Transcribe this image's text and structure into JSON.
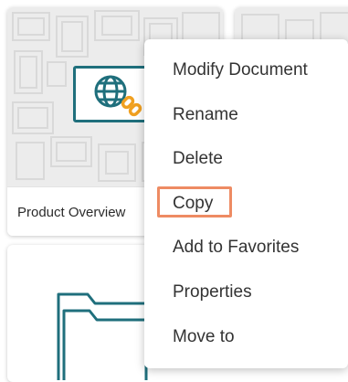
{
  "cards": [
    {
      "title": "Product Overview",
      "icon": "globe-link-icon"
    },
    {
      "title": "",
      "icon": "document-icon"
    },
    {
      "title": "",
      "icon": "folder-icon"
    }
  ],
  "context_menu": {
    "items": [
      {
        "label": "Modify Document",
        "highlighted": false
      },
      {
        "label": "Rename",
        "highlighted": false
      },
      {
        "label": "Delete",
        "highlighted": false
      },
      {
        "label": "Copy",
        "highlighted": true
      },
      {
        "label": "Add to Favorites",
        "highlighted": false
      },
      {
        "label": "Properties",
        "highlighted": false
      },
      {
        "label": "Move to",
        "highlighted": false
      }
    ]
  },
  "colors": {
    "accent_teal": "#1f6f7c",
    "highlight_orange": "#ee8b63",
    "link_orange": "#f0a020"
  }
}
